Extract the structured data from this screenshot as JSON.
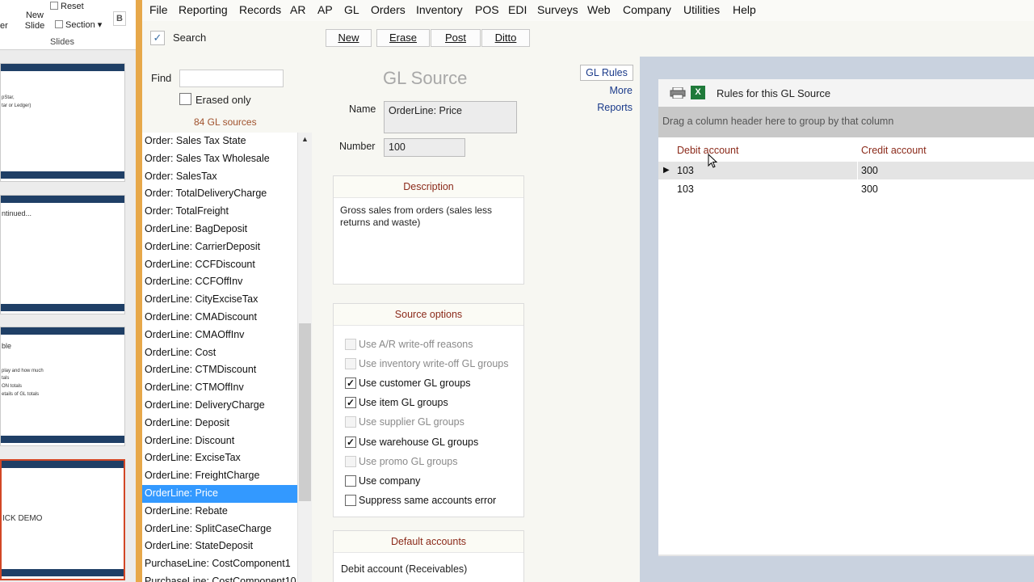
{
  "ppt": {
    "new_slide_label": "New\nSlide",
    "reset_label": "Reset",
    "section_label": "Section",
    "group_label": "Slides",
    "bold_label": "B",
    "slides": [
      {
        "lines": [
          "pStar,",
          "tar or Ledger)"
        ]
      },
      {
        "lines": [
          "ntinued..."
        ]
      },
      {
        "lines": [
          "ble",
          "play and how much",
          "tals",
          "ON totals",
          "etails of GL totals"
        ]
      },
      {
        "lines": [
          "ICK DEMO"
        ]
      }
    ]
  },
  "menu": [
    "File",
    "Reporting",
    "Records",
    "AR",
    "AP",
    "GL",
    "Orders",
    "Inventory",
    "POS",
    "EDI",
    "Surveys",
    "Web",
    "Company",
    "Utilities",
    "Help"
  ],
  "toolbar": {
    "search_label": "Search",
    "buttons": [
      "New",
      "Erase",
      "Post",
      "Ditto"
    ]
  },
  "list_panel": {
    "find_label": "Find",
    "find_value": "",
    "erased_only_label": "Erased only",
    "count_label": "84 GL sources",
    "items": [
      "Order: Sales Tax State",
      "Order: Sales Tax Wholesale",
      "Order: SalesTax",
      "Order: TotalDeliveryCharge",
      "Order: TotalFreight",
      "OrderLine: BagDeposit",
      "OrderLine: CarrierDeposit",
      "OrderLine: CCFDiscount",
      "OrderLine: CCFOffInv",
      "OrderLine: CityExciseTax",
      "OrderLine: CMADiscount",
      "OrderLine: CMAOffInv",
      "OrderLine: Cost",
      "OrderLine: CTMDiscount",
      "OrderLine: CTMOffInv",
      "OrderLine: DeliveryCharge",
      "OrderLine: Deposit",
      "OrderLine: Discount",
      "OrderLine: ExciseTax",
      "OrderLine: FreightCharge",
      "OrderLine: Price",
      "OrderLine: Rebate",
      "OrderLine: SplitCaseCharge",
      "OrderLine: StateDeposit",
      "PurchaseLine: CostComponent1",
      "PurchaseLine: CostComponent10"
    ],
    "selected_index": 20
  },
  "form": {
    "title": "GL Source",
    "name_label": "Name",
    "name_value": "OrderLine: Price",
    "number_label": "Number",
    "number_value": "100",
    "description_head": "Description",
    "description_text": "Gross sales from orders (sales less returns and waste)",
    "source_options_head": "Source options",
    "options": [
      {
        "label": "Use A/R write-off reasons",
        "checked": false,
        "disabled": true
      },
      {
        "label": "Use inventory write-off GL groups",
        "checked": false,
        "disabled": true
      },
      {
        "label": "Use customer GL groups",
        "checked": true,
        "disabled": false
      },
      {
        "label": "Use item GL groups",
        "checked": true,
        "disabled": false
      },
      {
        "label": "Use supplier GL groups",
        "checked": false,
        "disabled": true
      },
      {
        "label": "Use warehouse GL groups",
        "checked": true,
        "disabled": false
      },
      {
        "label": "Use promo GL groups",
        "checked": false,
        "disabled": true
      },
      {
        "label": "Use company",
        "checked": false,
        "disabled": false
      },
      {
        "label": "Suppress same accounts error",
        "checked": false,
        "disabled": false
      }
    ],
    "default_accounts_head": "Default accounts",
    "debit_account_label": "Debit account (Receivables)"
  },
  "links": {
    "gl_rules": "GL Rules",
    "more": "More",
    "reports": "Reports"
  },
  "rules": {
    "title": "Rules for this GL Source",
    "group_hint": "Drag a column header here to group by that column",
    "columns": [
      "Debit account",
      "Credit account"
    ],
    "rows": [
      {
        "debit": "103",
        "credit": "300"
      },
      {
        "debit": "103",
        "credit": "300"
      }
    ]
  }
}
